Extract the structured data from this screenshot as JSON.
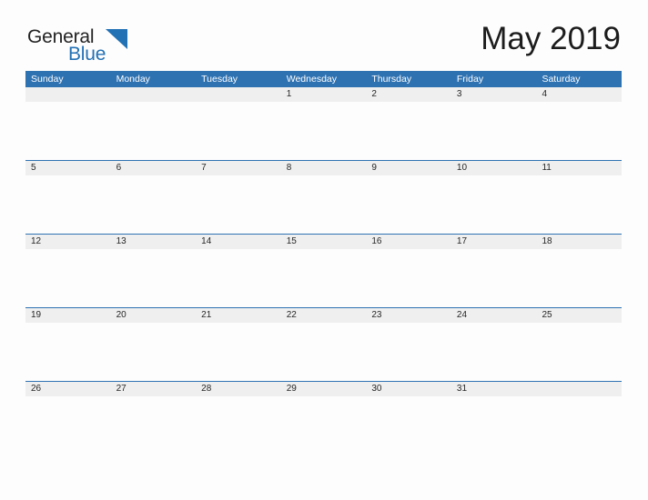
{
  "brand": {
    "name_part1": "General",
    "name_part2": "Blue",
    "flag_color": "#2271b5",
    "text_color": "#232323"
  },
  "header": {
    "title": "May 2019"
  },
  "theme": {
    "header_blue": "#2e72b2",
    "date_band_gray": "#efefef",
    "rule_blue": "#2e72b2",
    "page_background": "#fdfdfd"
  },
  "calendar": {
    "weekdays": [
      "Sunday",
      "Monday",
      "Tuesday",
      "Wednesday",
      "Thursday",
      "Friday",
      "Saturday"
    ],
    "weeks": [
      {
        "days": [
          "",
          "",
          "",
          "1",
          "2",
          "3",
          "4"
        ]
      },
      {
        "days": [
          "5",
          "6",
          "7",
          "8",
          "9",
          "10",
          "11"
        ]
      },
      {
        "days": [
          "12",
          "13",
          "14",
          "15",
          "16",
          "17",
          "18"
        ]
      },
      {
        "days": [
          "19",
          "20",
          "21",
          "22",
          "23",
          "24",
          "25"
        ]
      },
      {
        "days": [
          "26",
          "27",
          "28",
          "29",
          "30",
          "31",
          ""
        ]
      }
    ]
  }
}
